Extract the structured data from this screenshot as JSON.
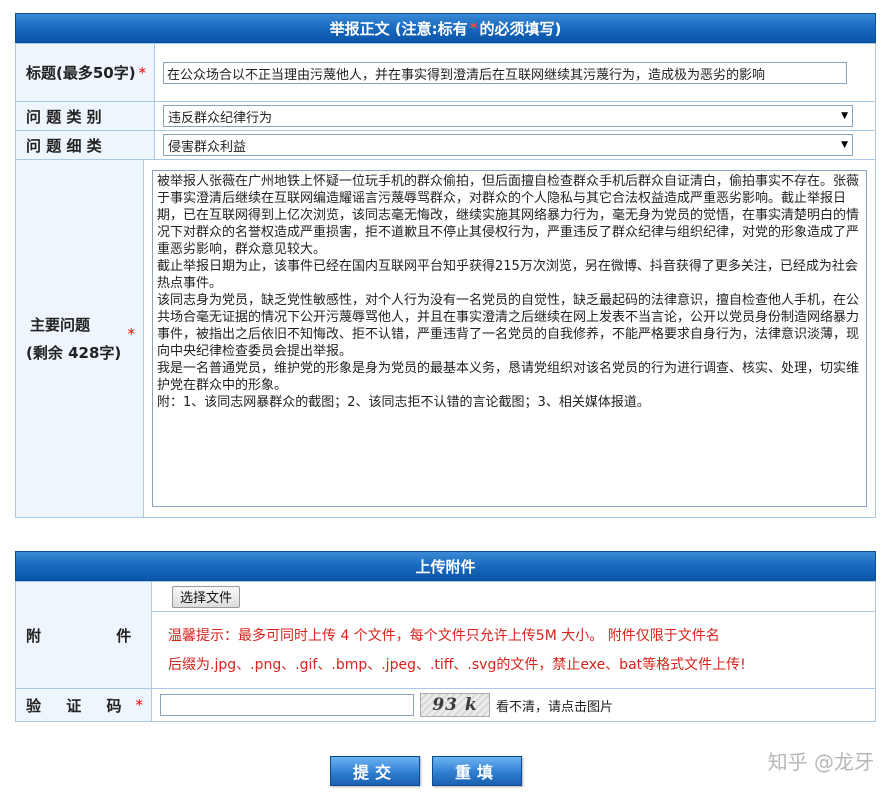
{
  "report_section": {
    "header_prefix": "举报正文 (注意:标有",
    "header_star": "*",
    "header_suffix": "的必须填写)",
    "title_label": "标题(最多50字)",
    "title_value": "在公众场合以不正当理由污蔑他人，并在事实得到澄清后在互联网继续其污蔑行为，造成极为恶劣的影响",
    "category_label": "问 题 类 别",
    "category_value": "违反群众纪律行为",
    "detail_label": "问 题 细 类",
    "detail_value": "侵害群众利益",
    "main_issue_label": "主要问题",
    "main_issue_remaining": "(剩余 428字)",
    "required_mark": "*",
    "main_issue_paragraphs": [
      "被举报人张薇在广州地铁上怀疑一位玩手机的群众偷拍，但后面擅自检查群众手机后群众自证清白，偷拍事实不存在。张薇于事实澄清后继续在互联网编造耀谣言污蔑辱骂群众，对群众的个人隐私与其它合法权益造成严重恶劣影响。截止举报日期，已在互联网得到上亿次浏览，该同志毫无悔改，继续实施其网络暴力行为，毫无身为党员的觉悟，在事实清楚明白的情况下对群众的名誉权造成严重损害，拒不道歉且不停止其侵权行为，严重违反了群众纪律与组织纪律，对党的形象造成了严重恶劣影响，群众意见较大。",
      "截止举报日期为止，该事件已经在国内互联网平台知乎获得215万次浏览，另在微博、抖音获得了更多关注，已经成为社会热点事件。",
      "该同志身为党员，缺乏党性敏感性，对个人行为没有一名党员的自觉性，缺乏最起码的法律意识，擅自检查他人手机，在公共场合毫无证据的情况下公开污蔑辱骂他人，并且在事实澄清之后继续在网上发表不当言论，公开以党员身份制造网络暴力事件，被指出之后依旧不知悔改、拒不认错，严重违背了一名党员的自我修养，不能严格要求自身行为，法律意识淡薄，现向中央纪律检查委员会提出举报。",
      "我是一名普通党员，维护党的形象是身为党员的最基本义务，恳请党组织对该名党员的行为进行调查、核实、处理，切实维护党在群众中的形象。",
      "附：1、该同志网暴群众的截图；2、该同志拒不认错的言论截图；3、相关媒体报道。"
    ]
  },
  "upload_section": {
    "header": "上传附件",
    "attachment_label": "附 件",
    "choose_file_label": "选择文件",
    "hint_line1": "温馨提示：最多可同时上传 4 个文件，每个文件只允许上传5M 大小。 附件仅限于文件名",
    "hint_line2": "后缀为.jpg、.png、.gif、.bmp、.jpeg、.tiff、.svg的文件，禁止exe、bat等格式文件上传!",
    "captcha_label": "验 证 码",
    "captcha_text": "93 k",
    "captcha_hint": "看不清，请点击图片"
  },
  "buttons": {
    "submit_label": "提交",
    "reset_label": "重填"
  },
  "watermark": "知乎 @龙牙",
  "colors": {
    "header_blue": "#1769bf",
    "label_bg": "#eef5fc",
    "border": "#a9c9e8",
    "required_red": "#e00000",
    "hint_red": "#d6231c"
  }
}
